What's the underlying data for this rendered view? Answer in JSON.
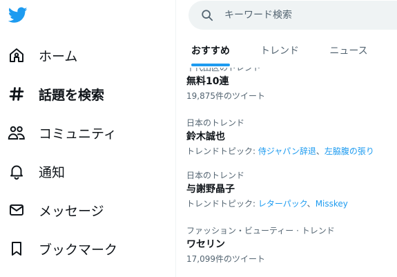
{
  "colors": {
    "accent": "#1d9bf0",
    "text_primary": "#0f1419",
    "text_secondary": "#536471",
    "search_bg": "#eff3f4"
  },
  "logo": {
    "icon": "twitter-bird-icon"
  },
  "nav": {
    "items": [
      {
        "icon": "home-icon",
        "label": "ホーム"
      },
      {
        "icon": "hashtag-icon",
        "label": "話題を検索"
      },
      {
        "icon": "communities-icon",
        "label": "コミュニティ"
      },
      {
        "icon": "bell-icon",
        "label": "通知"
      },
      {
        "icon": "mail-icon",
        "label": "メッセージ"
      },
      {
        "icon": "bookmark-icon",
        "label": "ブックマーク"
      }
    ]
  },
  "search": {
    "placeholder": "キーワード検索",
    "icon": "search-icon"
  },
  "tabs": [
    {
      "label": "おすすめ",
      "active": true
    },
    {
      "label": "トレンド",
      "active": false
    },
    {
      "label": "ニュース",
      "active": false
    }
  ],
  "trends": [
    {
      "context": "千代田区のトレンド",
      "name": "無料10連",
      "meta": "19,875件のツイート"
    },
    {
      "context": "日本のトレンド",
      "name": "鈴木誠也",
      "meta_prefix": "トレンドトピック: ",
      "topic1": "侍ジャパン辞退",
      "sep": "、",
      "topic2": "左脇腹の張り"
    },
    {
      "context": "日本のトレンド",
      "name": "与謝野晶子",
      "meta_prefix": "トレンドトピック: ",
      "topic1": "レターパック",
      "sep": "、",
      "topic2": "Misskey"
    },
    {
      "context": "ファッション・ビューティー · トレンド",
      "name": "ワセリン",
      "meta": "17,099件のツイート"
    }
  ]
}
